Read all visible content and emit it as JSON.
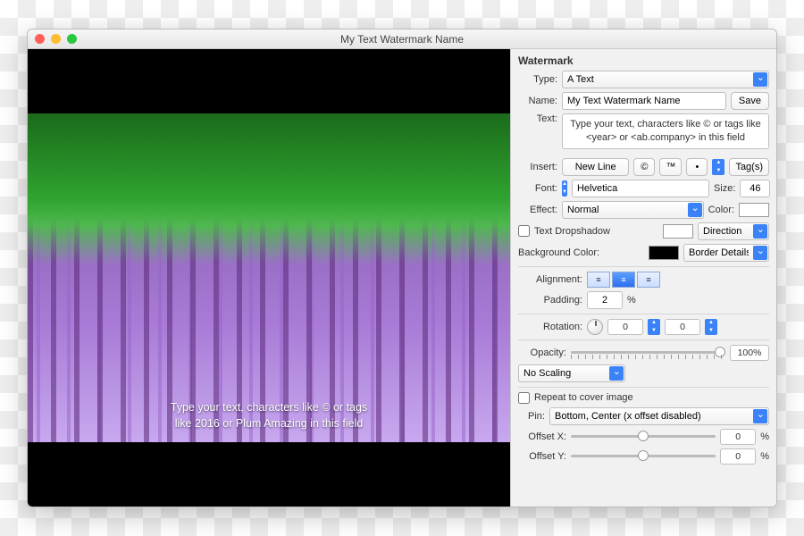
{
  "window": {
    "title": "My Text Watermark Name"
  },
  "preview": {
    "overlay_line1": "Type your text, characters like © or tags",
    "overlay_line2": "like 2016 or Plum Amazing in this field"
  },
  "panel": {
    "heading": "Watermark",
    "type_label": "Type:",
    "type_value": "A  Text",
    "name_label": "Name:",
    "name_value": "My Text Watermark Name",
    "save": "Save",
    "text_label": "Text:",
    "text_value": "Type your text, characters like © or tags like <year> or <ab.company> in this field",
    "insert_label": "Insert:",
    "insert_newline": "New Line",
    "insert_c": "©",
    "insert_tm": "™",
    "insert_bullet": "•",
    "insert_tags": "Tag(s)",
    "font_label": "Font:",
    "font_value": "Helvetica",
    "size_label": "Size:",
    "size_value": "46",
    "effect_label": "Effect:",
    "effect_value": "Normal",
    "color_label": "Color:",
    "dropshadow_label": "Text Dropshadow",
    "direction": "Direction",
    "bgcolor_label": "Background Color:",
    "border_details": "Border Details",
    "alignment_label": "Alignment:",
    "padding_label": "Padding:",
    "padding_value": "2",
    "pct": "%",
    "rotation_label": "Rotation:",
    "rotation_a": "0",
    "rotation_b": "0",
    "opacity_label": "Opacity:",
    "opacity_value": "100%",
    "scaling_value": "No Scaling",
    "repeat_label": "Repeat to cover image",
    "pin_label": "Pin:",
    "pin_value": "Bottom, Center (x offset disabled)",
    "offsetx_label": "Offset X:",
    "offsetx_value": "0",
    "offsety_label": "Offset Y:",
    "offsety_value": "0"
  }
}
